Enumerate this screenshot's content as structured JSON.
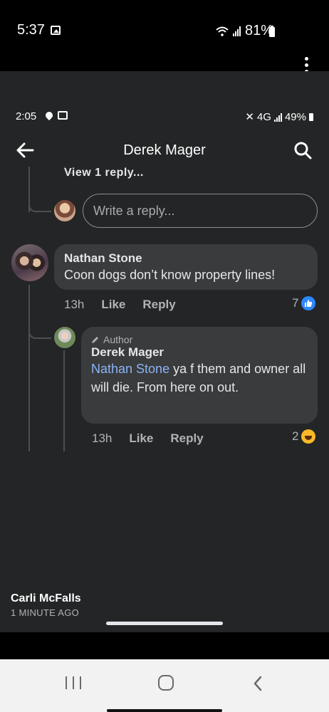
{
  "outer_status": {
    "time": "5:37",
    "battery_text": "81%"
  },
  "inner_status": {
    "time": "2:05",
    "network": "4G",
    "battery_text": "49%"
  },
  "header": {
    "title": "Derek Mager"
  },
  "thread": {
    "view_replies_label": "View 1 reply...",
    "reply_placeholder": "Write a reply...",
    "comments": [
      {
        "name": "Nathan Stone",
        "text": "Coon dogs don’t know property lines!",
        "time": "13h",
        "like_label": "Like",
        "reply_label": "Reply",
        "reaction_count": "7",
        "reaction_type": "like"
      },
      {
        "author_badge": "Author",
        "name": "Derek Mager",
        "mention": "Nathan Stone",
        "text": " ya f them and owner all will die. From here on out.",
        "time": "13h",
        "like_label": "Like",
        "reply_label": "Reply",
        "reaction_count": "2",
        "reaction_type": "haha"
      }
    ]
  },
  "footer": {
    "poster_name": "Carli McFalls",
    "poster_time": "1 MINUTE AGO"
  },
  "icons": {
    "back": "arrow-left-icon",
    "search": "search-icon",
    "more": "kebab-icon",
    "like": "like-reaction-icon",
    "haha": "haha-reaction-icon",
    "author": "pencil-icon"
  },
  "colors": {
    "screen_bg": "#242526",
    "bubble_bg": "#3a3b3c",
    "mention": "#8ab4f8",
    "like_blue": "#2d88ff",
    "haha_yellow": "#f7b928"
  }
}
